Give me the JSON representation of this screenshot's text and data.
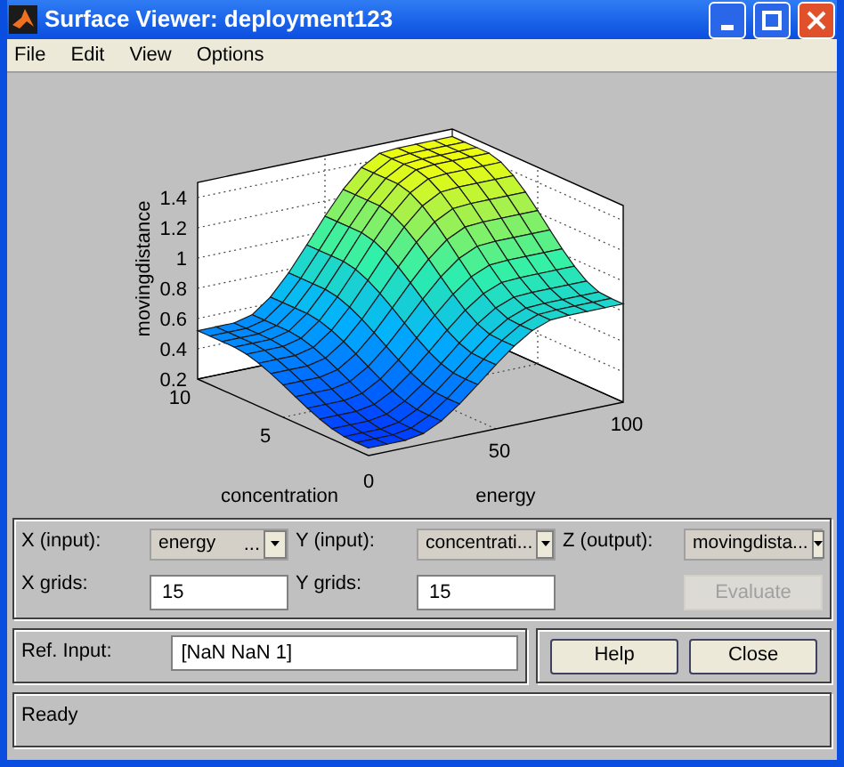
{
  "window": {
    "title": "Surface Viewer: deployment123"
  },
  "menu": [
    "File",
    "Edit",
    "View",
    "Options"
  ],
  "plot": {
    "zlabel": "movingdistance",
    "xlabel": "energy",
    "ylabel": "concentration",
    "origin_tick": "0",
    "zticks": [
      "1.4",
      "1.2",
      "1",
      "0.8",
      "0.6",
      "0.4",
      "0.2"
    ],
    "xticks": [
      "50",
      "100"
    ],
    "yticks": [
      "5",
      "10"
    ]
  },
  "selectors": [
    {
      "label": "X (input):",
      "value": "energy",
      "suffix": "..."
    },
    {
      "label": "Y (input):",
      "value": "concentrati..."
    },
    {
      "label": "Z (output):",
      "value": "movingdista..."
    }
  ],
  "grids": [
    {
      "label": "X grids:",
      "value": "15"
    },
    {
      "label": "Y grids:",
      "value": "15"
    }
  ],
  "evaluate": {
    "label": "Evaluate",
    "disabled": true
  },
  "ref_input": {
    "label": "Ref. Input:",
    "value": "[NaN NaN 1]"
  },
  "buttons": [
    "Help",
    "Close"
  ],
  "status_bar": "Ready"
}
